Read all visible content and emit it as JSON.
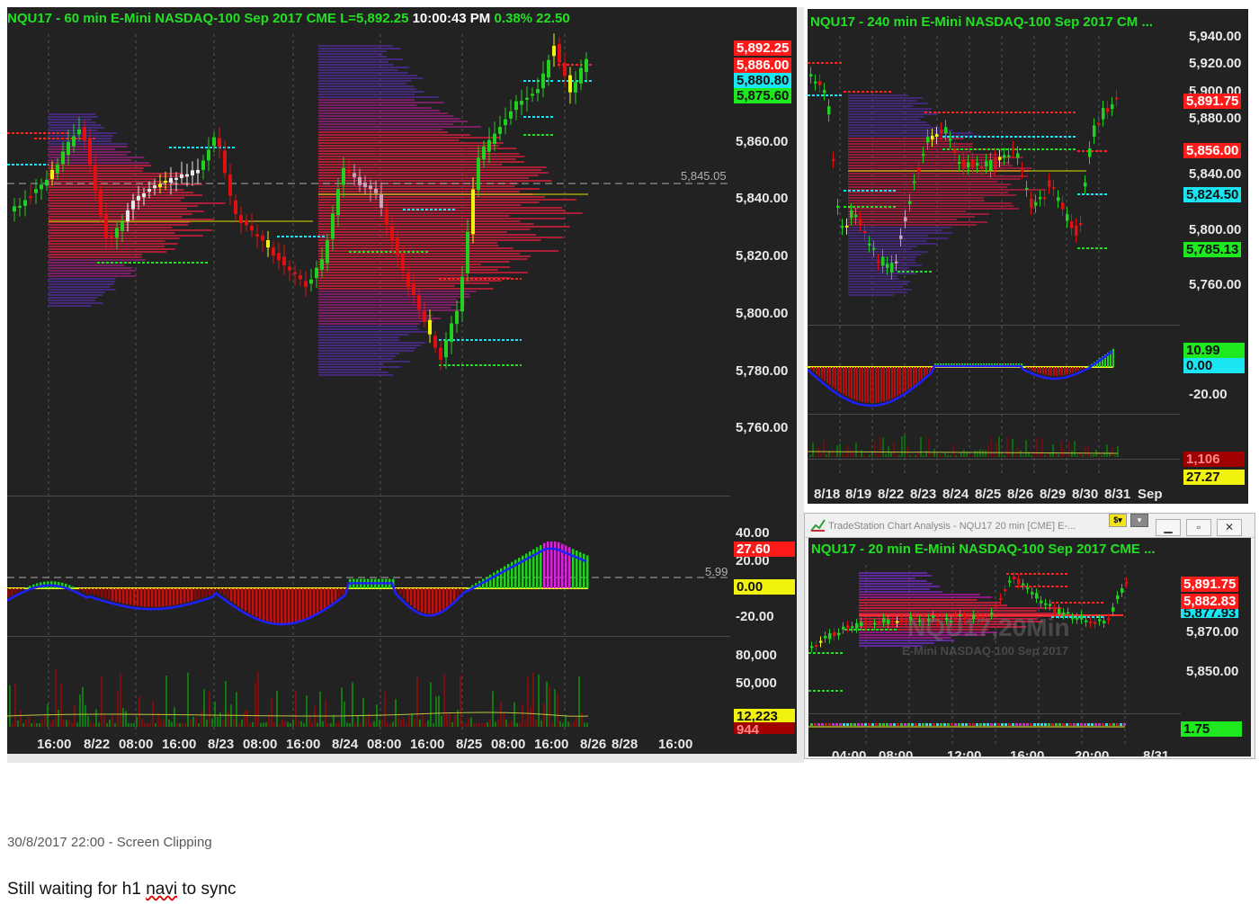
{
  "colors": {
    "accent_green": "#21e021",
    "price_red": "#ff1a1a",
    "cyan": "#19e6f2",
    "yellow": "#f2f20f",
    "bg": "#222222"
  },
  "main_chart": {
    "title": "NQU17 - 60 min  E-Mini NASDAQ-100 Sep 2017  CME  L=5,892.25",
    "clock": "10:00:43 PM",
    "change": "0.38%  22.50",
    "price_axis": [
      "5,860.00",
      "5,840.00",
      "5,820.00",
      "5,800.00",
      "5,780.00",
      "5,760.00"
    ],
    "price_tags": [
      "5,892.25",
      "5,886.00",
      "5,880.80",
      "5,875.60"
    ],
    "ref_line_label": "5,845.05",
    "osc_axis": [
      "40.00",
      "20.00",
      "-20.00"
    ],
    "osc_tags": [
      "27.60",
      "0.00"
    ],
    "osc_ref_label": "5.99",
    "vol_axis": [
      "80,000",
      "50,000"
    ],
    "vol_tags": [
      "12,223",
      "944"
    ],
    "time_axis": [
      "16:00",
      "8/22",
      "08:00",
      "16:00",
      "8/23",
      "08:00",
      "16:00",
      "8/24",
      "08:00",
      "16:00",
      "8/25",
      "08:00",
      "16:00",
      "8/26",
      "8/28",
      "16:00"
    ]
  },
  "chart_240": {
    "title": "NQU17 - 240 min  E-Mini NASDAQ-100 Sep 2017  CM ...",
    "price_axis": [
      "5,940.00",
      "5,920.00",
      "5,900.00",
      "5,880.00",
      "5,840.00",
      "5,800.00",
      "5,760.00"
    ],
    "price_tags": [
      "5,891.75",
      "5,856.00",
      "5,824.50",
      "5,785.13"
    ],
    "osc_tags": [
      "10.99",
      "0.00"
    ],
    "osc_axis": [
      "-20.00"
    ],
    "vol_tags": [
      "1,106",
      "27.27"
    ],
    "time_axis": [
      "8/18",
      "8/19",
      "8/22",
      "8/23",
      "8/24",
      "8/25",
      "8/26",
      "8/29",
      "8/30",
      "8/31",
      "Sep"
    ]
  },
  "chart_20": {
    "window_title": "TradeStation Chart Analysis - NQU17 20 min [CME] E-...",
    "title": "NQU17 - 20 min  E-Mini NASDAQ-100 Sep 2017  CME ...",
    "watermark": "NQU17,20Min",
    "watermark_sub": "E-Mini NASDAQ-100 Sep 2017",
    "price_axis": [
      "5,870.00",
      "5,850.00"
    ],
    "price_tags": [
      "5,891.75",
      "5,882.83",
      "5,877.93"
    ],
    "osc_tag": "1.75",
    "time_axis": [
      "04:00",
      "08:00",
      "12:00",
      "16:00",
      "20:00",
      "8/31"
    ]
  },
  "clipping": {
    "caption": "30/8/2017 22:00 - Screen Clipping",
    "note_before": "Still waiting for h1 ",
    "note_word": "navi",
    "note_after": " to sync"
  }
}
